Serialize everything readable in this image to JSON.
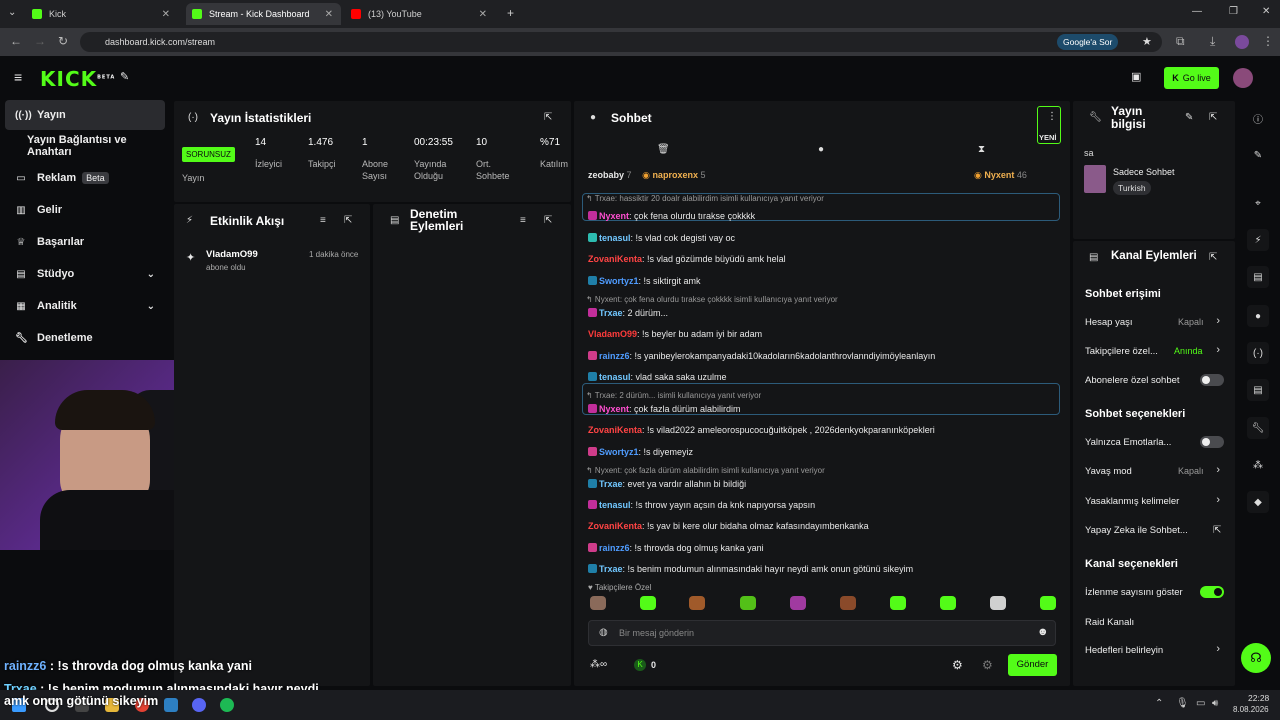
{
  "browser": {
    "tabs": [
      {
        "title": "Kick",
        "icon_color": "#53fc18"
      },
      {
        "title": "Stream - Kick Dashboard",
        "icon_color": "#53fc18"
      },
      {
        "title": "(13) YouTube",
        "icon_color": "#ff0000"
      }
    ],
    "url": "dashboard.kick.com/stream",
    "google_btn": "Google'a Sor"
  },
  "header": {
    "logo": "KICK",
    "logo_sup": "BETA",
    "go_live": "Go live"
  },
  "nav": {
    "items": [
      {
        "label": "Yayın",
        "icon": "broadcast-icon"
      },
      {
        "label": "Yayın Bağlantısı ve Anahtarı",
        "icon": ""
      },
      {
        "label": "Reklam",
        "icon": "ad-icon",
        "badge": "Beta"
      },
      {
        "label": "Gelir",
        "icon": "chart-icon"
      },
      {
        "label": "Başarılar",
        "icon": "trophy-icon"
      },
      {
        "label": "Stüdyo",
        "icon": "studio-icon"
      },
      {
        "label": "Analitik",
        "icon": "analytics-icon"
      },
      {
        "label": "Denetleme",
        "icon": "wrench-icon"
      }
    ]
  },
  "stats": {
    "title": "Yayın İstatistikleri",
    "status": "SORUNSUZ",
    "status_label": "Yayın",
    "items": [
      {
        "value": "14",
        "label": "İzleyici"
      },
      {
        "value": "1.476",
        "label": "Takipçi"
      },
      {
        "value": "1",
        "label": "Abone Sayısı"
      },
      {
        "value": "00:23:55",
        "label": "Yayında Olduğu Süre"
      },
      {
        "value": "10",
        "label": "Ort. Sohbete Katılanlar"
      },
      {
        "value": "%71",
        "label": "Katılım"
      }
    ]
  },
  "activity": {
    "title": "Etkinlik Akışı",
    "event_user": "VladamO99",
    "event_text": "abone oldu",
    "event_time": "1 dakika önce"
  },
  "moderation": {
    "title": "Denetim Eylemleri"
  },
  "chat": {
    "title": "Sohbet",
    "new_label": "YENİ",
    "top_users": [
      {
        "name": "zeobaby",
        "count": "7"
      },
      {
        "name": "naproxenx",
        "count": "5"
      },
      {
        "name": "Nyxent",
        "count": "46"
      }
    ],
    "messages": [
      {
        "reply": "Trxae: hassiktir 20 doalr alabilirdim isimli kullanıcıya yanıt veriyor",
        "user": "Nyxent",
        "color": "#ff4fd1",
        "text": ": çok fena olurdu tırakse çokkkk",
        "highlight": true
      },
      {
        "user": "tenasul",
        "color": "#71c7ff",
        "text": ": !s vlad cok degisti vay oc"
      },
      {
        "user": "ZovaniKenta",
        "color": "#ff4444",
        "text": ": !s vlad gözümde büyüdü amk helal"
      },
      {
        "user": "Swortyz1",
        "color": "#4f9cff",
        "text": ": !s siktirgit amk"
      },
      {
        "reply": "Nyxent: çok fena olurdu tırakse çokkkk isimli kullanıcıya yanıt veriyor",
        "user": "Trxae",
        "color": "#71c7ff",
        "text": ": 2 dürüm..."
      },
      {
        "user": "VladamO99",
        "color": "#ff3b3b",
        "text": ": !s beyler bu adam iyi bir adam"
      },
      {
        "user": "rainzz6",
        "color": "#4f9cff",
        "text": ": !s yanibeylerokampanyadaki10kadoların6kadolanthrovlanndiyimöyleanlayın"
      },
      {
        "user": "tenasul",
        "color": "#71c7ff",
        "text": ": vlad saka saka uzulme"
      },
      {
        "reply": "Trxae: 2 dürüm... isimli kullanıcıya yanıt veriyor",
        "user": "Nyxent",
        "color": "#ff4fd1",
        "text": ": çok fazla dürüm alabilirdim",
        "highlight": true
      },
      {
        "user": "ZovaniKenta",
        "color": "#ff4444",
        "text": ": !s vilad2022 ameleorospucocuğuitköpek , 2026denkyokparanınköpekleri"
      },
      {
        "user": "Swortyz1",
        "color": "#4f9cff",
        "text": ": !s diyemeyiz"
      },
      {
        "reply": "Nyxent: çok fazla dürüm alabilirdim isimli kullanıcıya yanıt veriyor",
        "user": "Trxae",
        "color": "#71c7ff",
        "text": ": evet ya vardır allahın bi bildiği"
      },
      {
        "user": "tenasul",
        "color": "#71c7ff",
        "text": ": !s throw yayın açsın da knk napıyorsa yapsın"
      },
      {
        "user": "ZovaniKenta",
        "color": "#ff4444",
        "text": ": !s yav bi kere olur bidaha olmaz kafasındayımbenkanka"
      },
      {
        "user": "rainzz6",
        "color": "#4f9cff",
        "text": ": !s throvda dog olmuş kanka yani"
      },
      {
        "user": "Trxae",
        "color": "#71c7ff",
        "text": ": !s benim modumun alınmasındaki hayır neydi amk onun götünü sikeyim"
      }
    ],
    "followers_label": "Takipçilere Özel",
    "input_placeholder": "Bir mesaj gönderin",
    "points": "0",
    "send": "Gönder"
  },
  "stream_info": {
    "title": "Yayın bilgisi",
    "title_line2": "bilgisi",
    "title_line1": "Yayın",
    "stream_title": "sa",
    "category": "Sadece Sohbet",
    "tag": "Turkish"
  },
  "channel_actions": {
    "title": "Kanal Eylemleri",
    "chat_access": "Sohbet erişimi",
    "age": "Hesap yaşı",
    "age_val": "Kapalı",
    "followers": "Takipçilere özel...",
    "followers_val": "Anında",
    "subs": "Abonelere özel sohbet",
    "chat_options": "Sohbet seçenekleri",
    "emotes": "Yalnızca Emotlarla...",
    "slow": "Yavaş mod",
    "slow_val": "Kapalı",
    "banned": "Yasaklanmış kelimeler",
    "ai": "Yapay Zeka ile Sohbet...",
    "channel_options": "Kanal seçenekleri",
    "viewcount": "İzlenme sayısını göster",
    "raid": "Raid Kanalı",
    "goals": "Hedefleri belirleyin"
  },
  "overlay": {
    "line1_user": "rainzz6",
    "line1_text": " : !s throvda dog olmuş kanka yani",
    "line2_user": "Trxae",
    "line2_text": " : !s benim modumun alınmasındaki hayır neydi",
    "line3_text": "amk onun götünü sikeyim"
  },
  "taskbar": {
    "time": "22:28",
    "date": "8.08.2026"
  },
  "colors": {
    "brand": "#53fc18"
  }
}
